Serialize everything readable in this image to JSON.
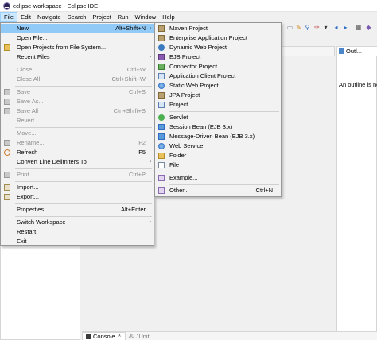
{
  "window": {
    "title": "eclipse-workspace - Eclipse IDE"
  },
  "menubar": [
    "File",
    "Edit",
    "Navigate",
    "Search",
    "Project",
    "Run",
    "Window",
    "Help"
  ],
  "file_menu": {
    "items": [
      {
        "label": "New",
        "accel": "Alt+Shift+N",
        "submenu": true,
        "highlighted": true,
        "enabled": true,
        "icon": "none"
      },
      {
        "label": "Open File...",
        "accel": "",
        "submenu": false,
        "enabled": true,
        "icon": "none"
      },
      {
        "label": "Open Projects from File System...",
        "accel": "",
        "submenu": false,
        "enabled": true,
        "icon": "folder-icon"
      },
      {
        "label": "Recent Files",
        "accel": "",
        "submenu": true,
        "enabled": true,
        "icon": "none"
      },
      {
        "label": "Close",
        "accel": "Ctrl+W",
        "submenu": false,
        "enabled": false,
        "icon": "none"
      },
      {
        "label": "Close All",
        "accel": "Ctrl+Shift+W",
        "submenu": false,
        "enabled": false,
        "icon": "none"
      },
      {
        "label": "Save",
        "accel": "Ctrl+S",
        "submenu": false,
        "enabled": false,
        "icon": "save-icon"
      },
      {
        "label": "Save As...",
        "accel": "",
        "submenu": false,
        "enabled": false,
        "icon": "save-as-icon"
      },
      {
        "label": "Save All",
        "accel": "Ctrl+Shift+S",
        "submenu": false,
        "enabled": false,
        "icon": "save-all-icon"
      },
      {
        "label": "Revert",
        "accel": "",
        "submenu": false,
        "enabled": false,
        "icon": "none"
      },
      {
        "label": "Move...",
        "accel": "",
        "submenu": false,
        "enabled": false,
        "icon": "none"
      },
      {
        "label": "Rename...",
        "accel": "F2",
        "submenu": false,
        "enabled": false,
        "icon": "rename-icon"
      },
      {
        "label": "Refresh",
        "accel": "F5",
        "submenu": false,
        "enabled": true,
        "icon": "refresh-icon"
      },
      {
        "label": "Convert Line Delimiters To",
        "accel": "",
        "submenu": true,
        "enabled": true,
        "icon": "none"
      },
      {
        "label": "Print...",
        "accel": "Ctrl+P",
        "submenu": false,
        "enabled": false,
        "icon": "print-icon"
      },
      {
        "label": "Import...",
        "accel": "",
        "submenu": false,
        "enabled": true,
        "icon": "import-icon"
      },
      {
        "label": "Export...",
        "accel": "",
        "submenu": false,
        "enabled": true,
        "icon": "export-icon"
      },
      {
        "label": "Properties",
        "accel": "Alt+Enter",
        "submenu": false,
        "enabled": true,
        "icon": "none"
      },
      {
        "label": "Switch Workspace",
        "accel": "",
        "submenu": true,
        "enabled": true,
        "icon": "none"
      },
      {
        "label": "Restart",
        "accel": "",
        "submenu": false,
        "enabled": true,
        "icon": "none"
      },
      {
        "label": "Exit",
        "accel": "",
        "submenu": false,
        "enabled": true,
        "icon": "none"
      }
    ]
  },
  "new_menu": {
    "items": [
      {
        "label": "Maven Project",
        "icon": "maven-project-icon"
      },
      {
        "label": "Enterprise Application Project",
        "icon": "ear-project-icon"
      },
      {
        "label": "Dynamic Web Project",
        "icon": "web-project-icon"
      },
      {
        "label": "EJB Project",
        "icon": "ejb-project-icon"
      },
      {
        "label": "Connector Project",
        "icon": "connector-project-icon"
      },
      {
        "label": "Application Client Project",
        "icon": "app-client-project-icon"
      },
      {
        "label": "Static Web Project",
        "icon": "static-web-project-icon"
      },
      {
        "label": "JPA Project",
        "icon": "jpa-project-icon"
      },
      {
        "label": "Project...",
        "icon": "project-icon"
      },
      {
        "label": "Servlet",
        "icon": "servlet-icon"
      },
      {
        "label": "Session Bean (EJB 3.x)",
        "icon": "session-bean-icon"
      },
      {
        "label": "Message-Driven Bean (EJB 3.x)",
        "icon": "mdb-icon"
      },
      {
        "label": "Web Service",
        "icon": "web-service-icon"
      },
      {
        "label": "Folder",
        "icon": "folder-icon"
      },
      {
        "label": "File",
        "icon": "file-icon"
      },
      {
        "label": "Example...",
        "icon": "example-icon"
      },
      {
        "label": "Other...",
        "accel": "Ctrl+N",
        "icon": "other-icon"
      }
    ]
  },
  "outline": {
    "tab_label": "Outl...",
    "message": "An outline is not"
  },
  "console": {
    "tabs": [
      "Console",
      "JUnit"
    ]
  }
}
